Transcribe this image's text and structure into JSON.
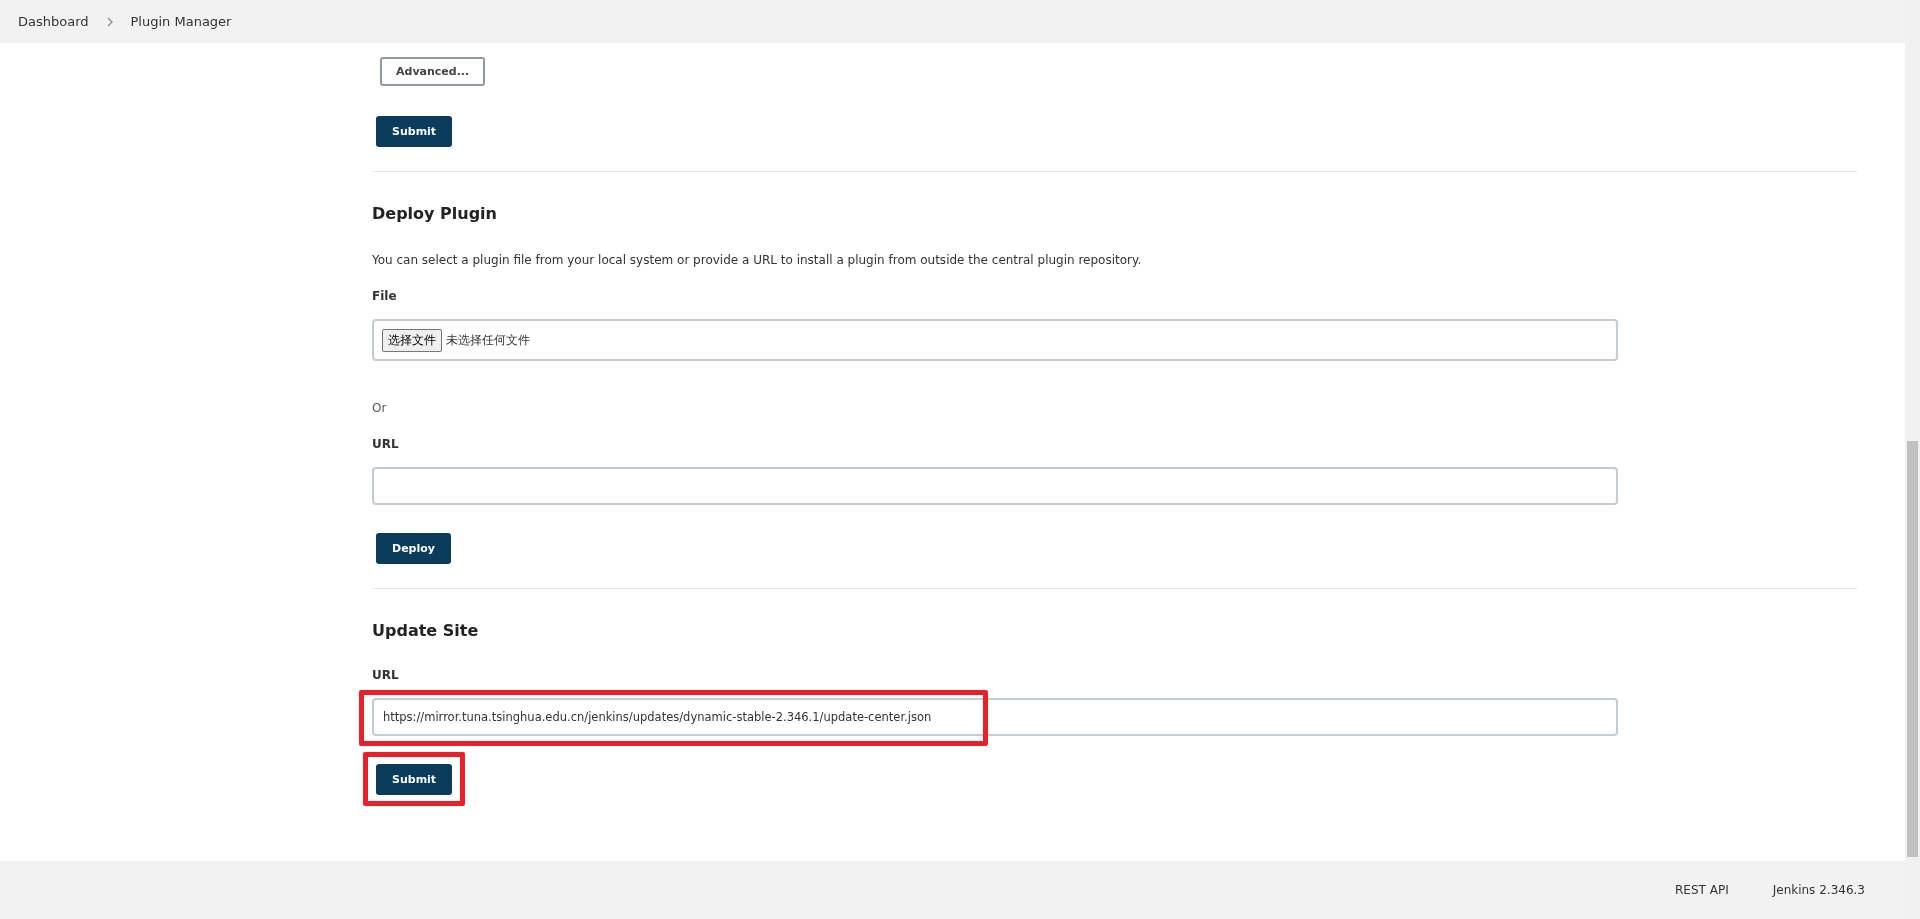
{
  "breadcrumbs": [
    "Dashboard",
    "Plugin Manager"
  ],
  "top": {
    "advanced_button": "Advanced...",
    "submit_button": "Submit"
  },
  "deploy": {
    "title": "Deploy Plugin",
    "description": "You can select a plugin file from your local system or provide a URL to install a plugin from outside the central plugin repository.",
    "file_label": "File",
    "file_button": "选择文件",
    "file_status": "未选择任何文件",
    "or": "Or",
    "url_label": "URL",
    "deploy_button": "Deploy"
  },
  "update_site": {
    "title": "Update Site",
    "url_label": "URL",
    "url_value": "https://mirror.tuna.tsinghua.edu.cn/jenkins/updates/dynamic-stable-2.346.1/update-center.json",
    "url_highlighted": true,
    "submit_button": "Submit",
    "submit_highlighted": true
  },
  "footer": {
    "links": [
      "REST API",
      "Jenkins 2.346.3"
    ]
  }
}
